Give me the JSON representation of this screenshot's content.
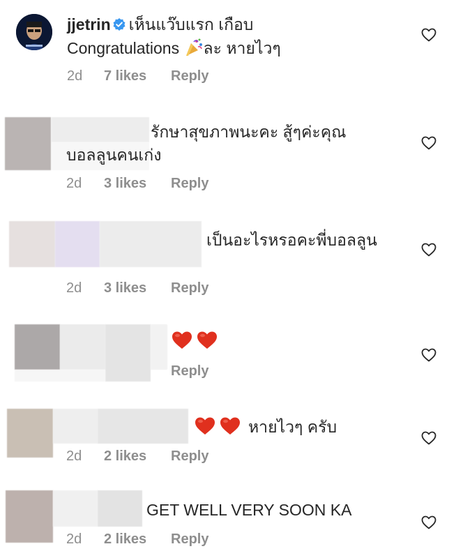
{
  "comments": [
    {
      "username": "jjetrin",
      "verified": true,
      "text_line1": "เห็นแว๊บแรก เกือบ",
      "text_line2_pre": "Congratulations",
      "text_line2_post": "ละ หายไวๆ",
      "time": "2d",
      "likes": "7 likes",
      "reply": "Reply"
    },
    {
      "text_line1": "รักษาสุขภาพนะคะ สู้ๆค่ะคุณ",
      "text_line2": "บอลลูนคนเก่ง",
      "time": "2d",
      "likes": "3 likes",
      "reply": "Reply"
    },
    {
      "text_line1": "เป็นอะไรหรอคะพี่บอลลูน",
      "time": "2d",
      "likes": "3 likes",
      "reply": "Reply"
    },
    {
      "emoji": "two-red-hearts",
      "reply": "Reply"
    },
    {
      "text_line1": "หายไวๆ ครับ",
      "time": "2d",
      "likes": "2 likes",
      "reply": "Reply"
    },
    {
      "text_line1": "GET WELL VERY SOON KA",
      "time": "2d",
      "likes": "2 likes",
      "reply": "Reply"
    }
  ],
  "icons": {
    "like": "heart-outline-icon",
    "verified": "verified-badge-icon",
    "party": "party-popper-emoji",
    "emoji_heart": "red-heart-emoji"
  },
  "colors": {
    "text": "#262626",
    "meta": "#8e8e8e",
    "verified": "#3897f0",
    "emoji_heart": "#e0301e"
  }
}
